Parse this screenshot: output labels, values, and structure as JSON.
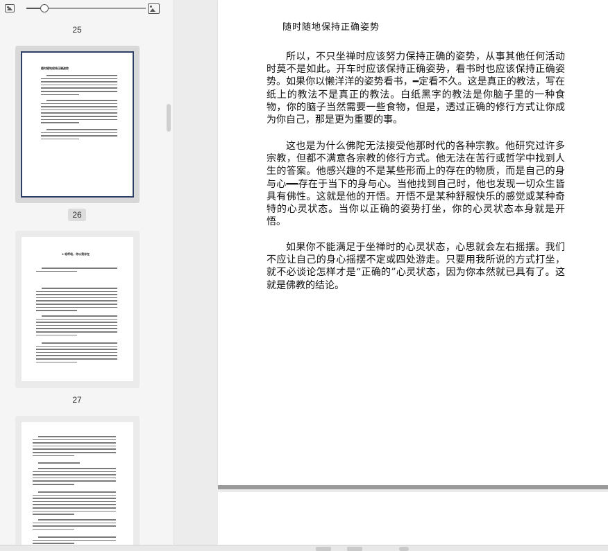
{
  "sidebar": {
    "zoom": {
      "level": 0.15
    },
    "pages": [
      {
        "number": "25"
      },
      {
        "number": "26",
        "selected": true,
        "title": "随时随地保持正确姿势"
      },
      {
        "number": "27",
        "title": "2 吸呼吸，你以我存在"
      }
    ]
  },
  "document": {
    "title": "随时随地保持正确姿势",
    "paragraphs": [
      "所以，不只坐禅时应该努力保持正确的姿势，从事其他任何活动时莫不是如此。开车时应该保持正确姿势，看书时也应该保持正确姿势。如果你以懒洋洋的姿势看书，━定看不久。这是真正的教法，写在纸上的教法不是真正的教法。白纸黑字的教法是你脑子里的一种食物，你的脑子当然需要一些食物，但是，透过正确的修行方式让你成为你自己，那是更为重要的事。",
      "这也是为什么佛陀无法接受他那时代的各种宗教。他研究过许多宗教，但都不满意各宗教的修行方式。他无法在苦行或哲学中找到人生的答案。他感兴趣的不是某些形而上的存在的物质，而是自己的身与心━━存在于当下的身与心。当他找到自己时，他也发现一切众生皆具有佛性。这就是他的开悟。开悟不是某种舒服快乐的感觉或某种奇特的心灵状态。当你以正确的姿势打坐，你的心灵状态本身就是开悟。",
      "如果你不能满足于坐禅时的心灵状态，心思就会左右摇摆。我们不应让自己的身心摇摆不定或四处游走。只要用我所说的方式打坐，就不必谈论怎样才是“正确的”心灵状态，因为你本然就已具有了。这就是佛教的结论。"
    ]
  }
}
